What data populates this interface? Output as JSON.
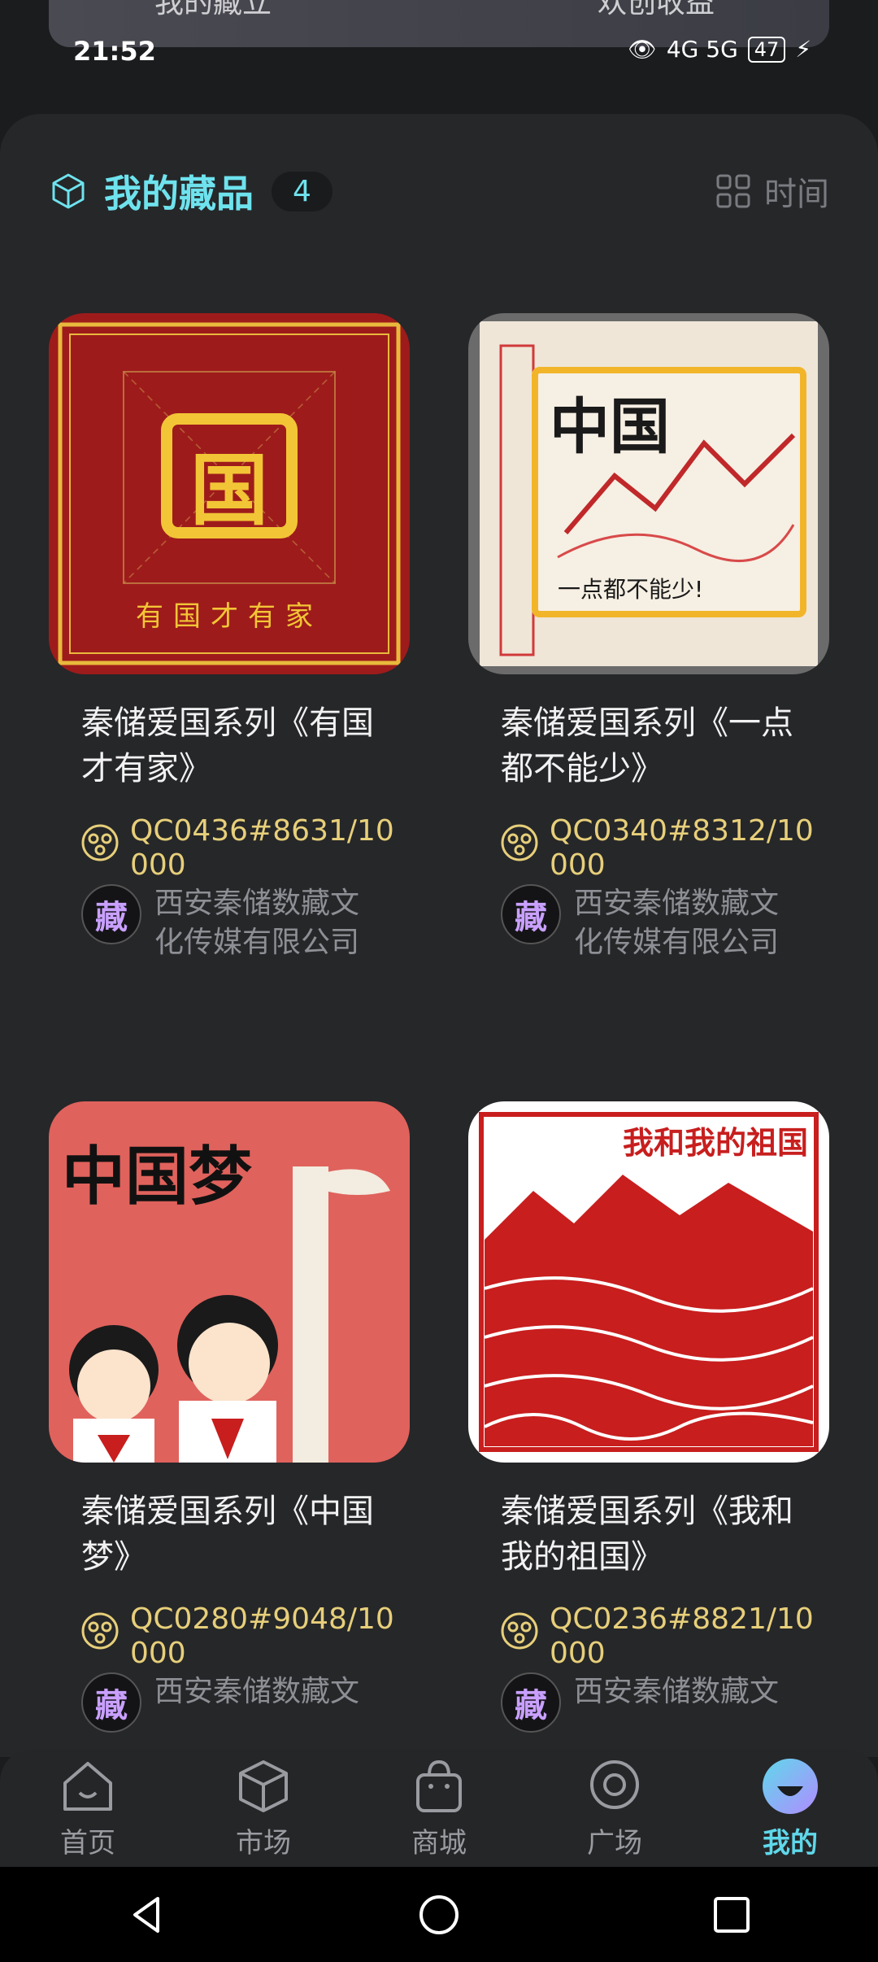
{
  "banner": {
    "left": "我的藏立",
    "right": "欢创收益"
  },
  "status": {
    "time": "21:52",
    "network": "4G 5G",
    "battery": "47"
  },
  "header": {
    "title": "我的藏品",
    "count": "4",
    "sort_label": "时间"
  },
  "cards": [
    {
      "name": "秦储爱国系列《有国才有家》",
      "code": "QC0436#8631/10000",
      "issuer": "西安秦储数藏文化传媒有限公司",
      "avatar_char": "藏",
      "image_text": "国",
      "image_caption": "有国才有家"
    },
    {
      "name": "秦储爱国系列《一点都不能少》",
      "code": "QC0340#8312/10000",
      "issuer": "西安秦储数藏文化传媒有限公司",
      "avatar_char": "藏",
      "image_text": "中国",
      "image_caption": "一点都不能少!"
    },
    {
      "name": "秦储爱国系列《中国梦》",
      "code": "QC0280#9048/10000",
      "issuer": "西安秦储数藏文",
      "avatar_char": "藏",
      "image_text": "中国梦"
    },
    {
      "name": "秦储爱国系列《我和我的祖国》",
      "code": "QC0236#8821/10000",
      "issuer": "西安秦储数藏文",
      "avatar_char": "藏",
      "image_text": "我和我的祖国"
    }
  ],
  "nav": [
    {
      "label": "首页",
      "icon": "home-icon"
    },
    {
      "label": "市场",
      "icon": "market-cube-icon"
    },
    {
      "label": "商城",
      "icon": "shopping-bag-icon"
    },
    {
      "label": "广场",
      "icon": "plaza-chat-icon"
    },
    {
      "label": "我的",
      "icon": "profile-icon",
      "active": true
    }
  ],
  "colors": {
    "accent": "#5fd8ea",
    "gold": "#e7cf7a",
    "panel": "#262729"
  }
}
